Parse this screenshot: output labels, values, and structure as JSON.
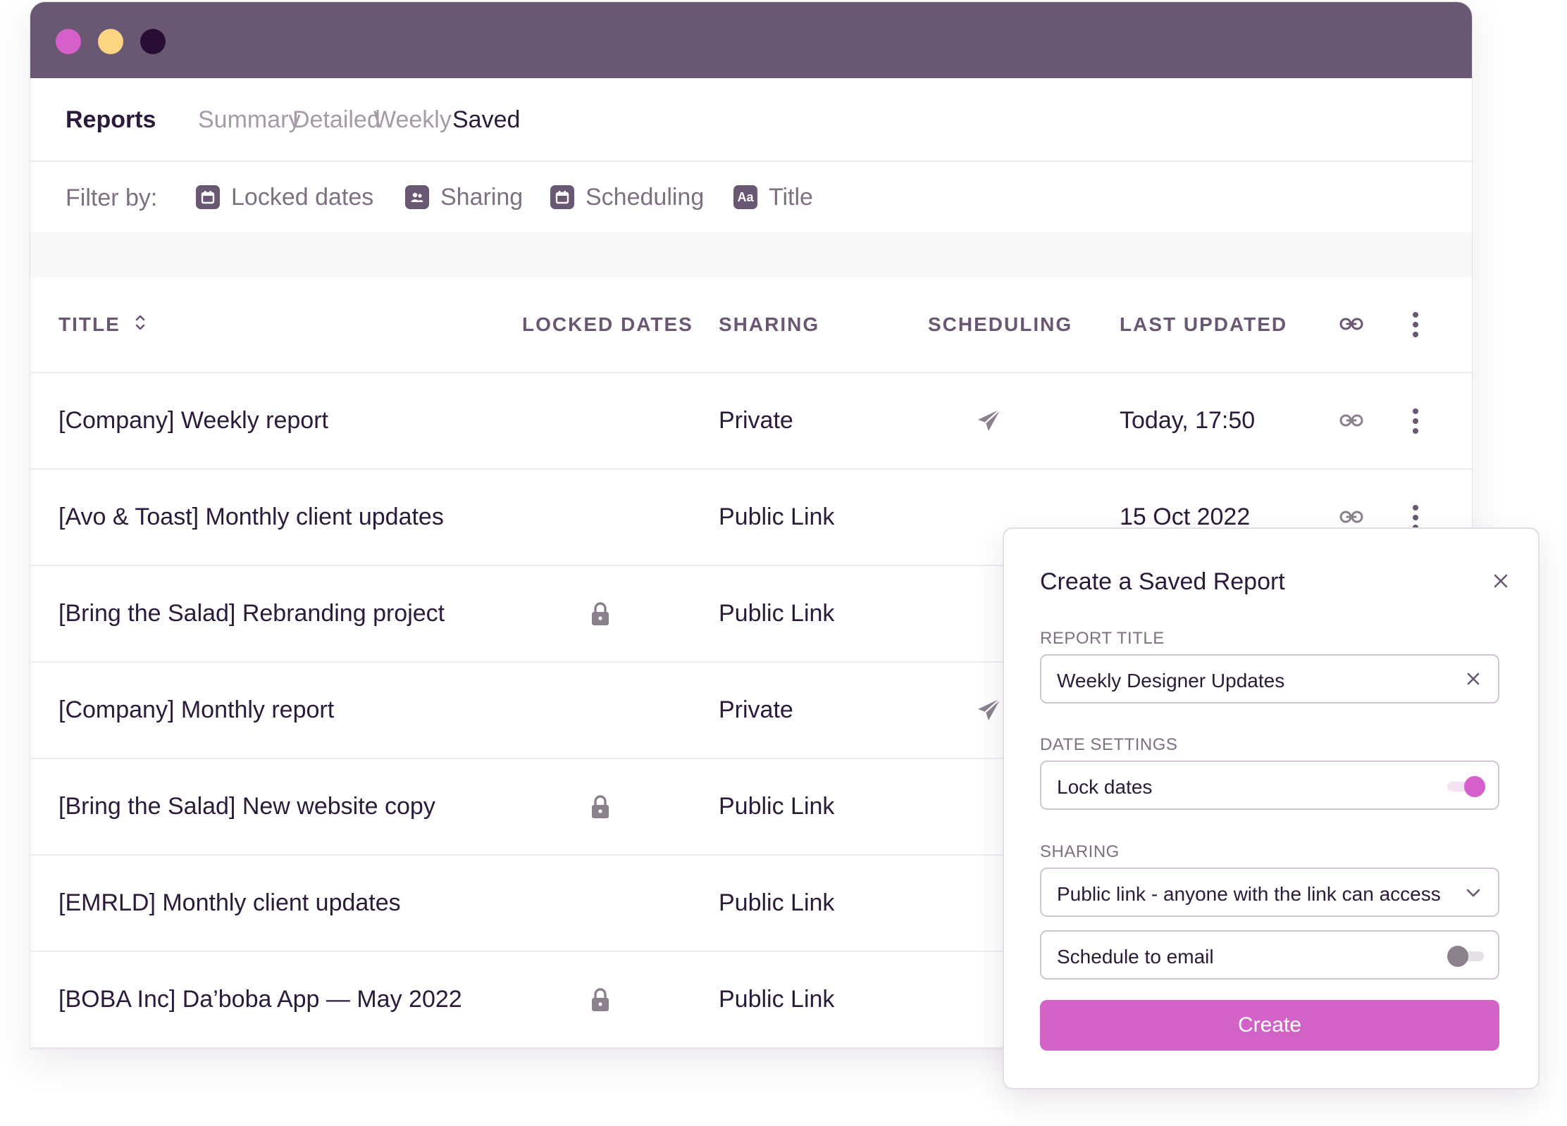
{
  "nav": {
    "title": "Reports",
    "tabs": [
      {
        "label": "Summary",
        "active": false
      },
      {
        "label": "Detailed",
        "active": false
      },
      {
        "label": "Weekly",
        "active": false
      },
      {
        "label": "Saved",
        "active": true
      }
    ]
  },
  "filter": {
    "label": "Filter by:",
    "items": [
      {
        "label": "Locked dates",
        "icon": "calendar-icon"
      },
      {
        "label": "Sharing",
        "icon": "people-icon"
      },
      {
        "label": "Scheduling",
        "icon": "calendar-icon"
      },
      {
        "label": "Title",
        "icon": "text-icon",
        "glyph": "Aa"
      }
    ]
  },
  "table": {
    "headers": {
      "title": "TITLE",
      "locked_dates": "LOCKED DATES",
      "sharing": "SHARING",
      "scheduling": "SCHEDULING",
      "last_updated": "LAST UPDATED"
    },
    "rows": [
      {
        "title": "[Company] Weekly report",
        "locked": false,
        "sharing": "Private",
        "scheduled": true,
        "last_updated": "Today, 17:50"
      },
      {
        "title": "[Avo & Toast] Monthly client updates",
        "locked": false,
        "sharing": "Public Link",
        "scheduled": false,
        "last_updated": "15 Oct 2022"
      },
      {
        "title": "[Bring the Salad] Rebranding project",
        "locked": true,
        "sharing": "Public Link",
        "scheduled": false,
        "last_updated": ""
      },
      {
        "title": "[Company] Monthly report",
        "locked": false,
        "sharing": "Private",
        "scheduled": true,
        "last_updated": ""
      },
      {
        "title": "[Bring the Salad] New website copy",
        "locked": true,
        "sharing": "Public Link",
        "scheduled": false,
        "last_updated": ""
      },
      {
        "title": "[EMRLD] Monthly client updates",
        "locked": false,
        "sharing": "Public Link",
        "scheduled": false,
        "last_updated": ""
      },
      {
        "title": "[BOBA Inc] Da’boba App — May 2022",
        "locked": true,
        "sharing": "Public Link",
        "scheduled": false,
        "last_updated": ""
      }
    ]
  },
  "panel": {
    "title": "Create a Saved Report",
    "report_title_label": "REPORT TITLE",
    "report_title_value": "Weekly Designer Updates",
    "date_settings_label": "DATE SETTINGS",
    "lock_dates_label": "Lock dates",
    "lock_dates_on": true,
    "sharing_label": "SHARING",
    "sharing_value": "Public link - anyone with the link can access",
    "schedule_label": "Schedule to email",
    "schedule_on": false,
    "create_label": "Create"
  },
  "colors": {
    "titlebar": "#6a5773",
    "accent": "#d362c6",
    "dot_pink": "#d560c9",
    "dot_yellow": "#fbd581",
    "dot_dark": "#2a0d33"
  }
}
